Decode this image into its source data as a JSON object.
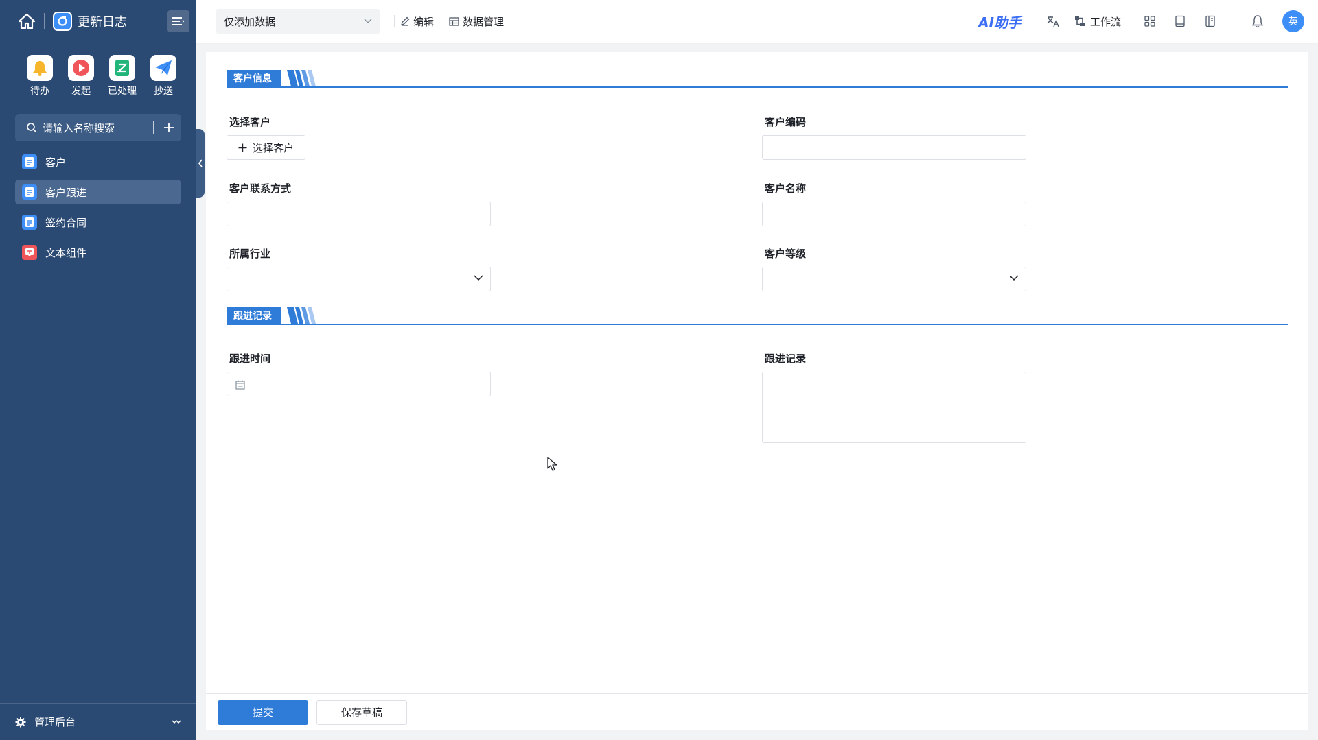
{
  "app": {
    "title": "更新日志"
  },
  "quick_actions": [
    {
      "label": "待办",
      "icon": "bell-icon",
      "color": "#f7b52c"
    },
    {
      "label": "发起",
      "icon": "play-icon",
      "color": "#f0555a"
    },
    {
      "label": "已处理",
      "icon": "check-doc-icon",
      "color": "#22b57a"
    },
    {
      "label": "抄送",
      "icon": "send-icon",
      "color": "#3e8ef7"
    }
  ],
  "sidebar": {
    "search_placeholder": "请输入名称搜索",
    "items": [
      {
        "label": "客户",
        "icon": "doc-icon",
        "active": false
      },
      {
        "label": "客户跟进",
        "icon": "doc-icon",
        "active": true
      },
      {
        "label": "签约合同",
        "icon": "doc-icon",
        "active": false
      },
      {
        "label": "文本组件",
        "icon": "text-widget-icon",
        "active": false
      }
    ],
    "bottom_label": "管理后台"
  },
  "header": {
    "mode_select": "仅添加数据",
    "edit_label": "编辑",
    "data_manage_label": "数据管理",
    "ai_label": "AI助手",
    "workflow_label": "工作流",
    "avatar_text": "英"
  },
  "form": {
    "section1_title": "客户信息",
    "section2_title": "跟进记录",
    "fields": {
      "select_customer_label": "选择客户",
      "select_customer_button": "选择客户",
      "customer_code_label": "客户编码",
      "customer_contact_label": "客户联系方式",
      "customer_name_label": "客户名称",
      "industry_label": "所属行业",
      "customer_level_label": "客户等级",
      "followup_time_label": "跟进时间",
      "followup_record_label": "跟进记录"
    }
  },
  "footer": {
    "submit_label": "提交",
    "save_draft_label": "保存草稿"
  },
  "colors": {
    "sidebar_bg": "#2b4a73",
    "accent": "#2f7bd8"
  }
}
